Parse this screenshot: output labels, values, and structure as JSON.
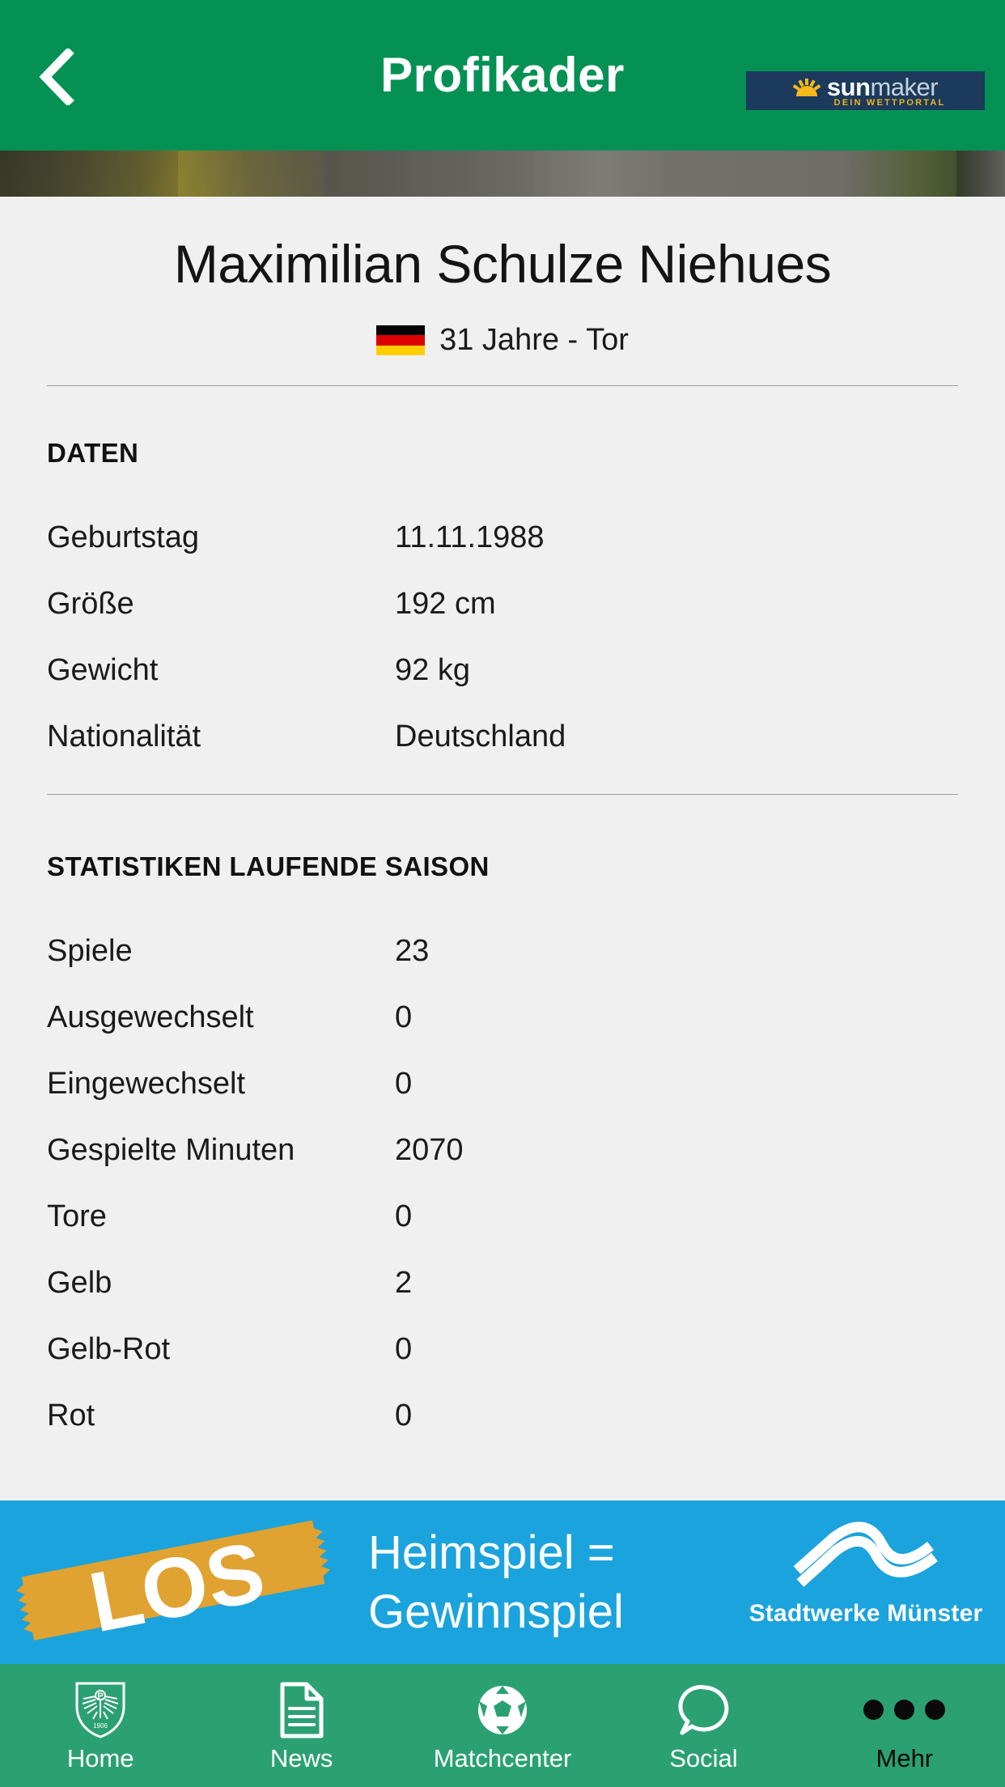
{
  "header": {
    "title": "Profikader",
    "back_icon": "chevron-left-icon",
    "sponsor": {
      "name_part1": "sun",
      "name_part2": "maker",
      "tagline": "DEIN WETTPORTAL",
      "bg_color": "#1b3a5c",
      "accent_color": "#f0b21e"
    },
    "bg_color": "#059154"
  },
  "player": {
    "name": "Maximilian Schulze Niehues",
    "flag_icon": "germany-flag-icon",
    "meta": "31 Jahre - Tor"
  },
  "daten": {
    "title": "DATEN",
    "rows": [
      {
        "label": "Geburtstag",
        "value": "11.11.1988"
      },
      {
        "label": "Größe",
        "value": "192 cm"
      },
      {
        "label": "Gewicht",
        "value": "92 kg"
      },
      {
        "label": "Nationalität",
        "value": "Deutschland"
      }
    ]
  },
  "statistiken": {
    "title": "STATISTIKEN LAUFENDE SAISON",
    "rows": [
      {
        "label": "Spiele",
        "value": "23"
      },
      {
        "label": "Ausgewechselt",
        "value": "0"
      },
      {
        "label": "Eingewechselt",
        "value": "0"
      },
      {
        "label": "Gespielte Minuten",
        "value": "2070"
      },
      {
        "label": "Tore",
        "value": "0"
      },
      {
        "label": "Gelb",
        "value": "2"
      },
      {
        "label": "Gelb-Rot",
        "value": "0"
      },
      {
        "label": "Rot",
        "value": "0"
      }
    ]
  },
  "ad": {
    "ticket_label": "LOS",
    "line1": "Heimspiel =",
    "line2": "Gewinnspiel",
    "brand": "Stadtwerke Münster",
    "bg_color": "#1ba3dd",
    "ticket_color": "#e0a230"
  },
  "nav": {
    "bg_color": "#2ba173",
    "items": [
      {
        "label": "Home",
        "icon": "club-crest-icon"
      },
      {
        "label": "News",
        "icon": "document-icon"
      },
      {
        "label": "Matchcenter",
        "icon": "soccer-ball-icon"
      },
      {
        "label": "Social",
        "icon": "speech-bubble-icon"
      },
      {
        "label": "Mehr",
        "icon": "more-dots-icon"
      }
    ]
  }
}
